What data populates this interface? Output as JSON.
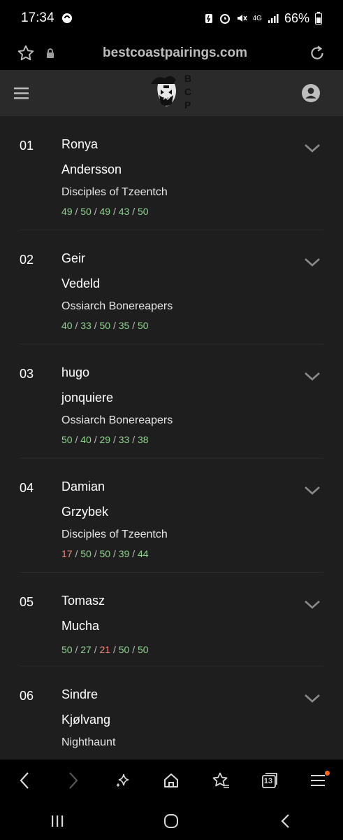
{
  "status_bar": {
    "time": "17:34",
    "network": "4G",
    "battery": "66%"
  },
  "address_bar": {
    "url": "bestcoastpairings.com"
  },
  "header": {
    "logo_letters": [
      "B",
      "C",
      "P"
    ]
  },
  "colors": {
    "score_good": "#8fd48f",
    "score_bad": "#f28b82",
    "header_bg": "#2a2a2a",
    "list_bg": "#1e1e1e",
    "notification": "#ff6d1f"
  },
  "players": [
    {
      "rank": "01",
      "first_name": "Ronya",
      "last_name": "Andersson",
      "faction": "Disciples of Tzeentch",
      "scores": [
        {
          "v": "49",
          "s": "g"
        },
        {
          "v": "50",
          "s": "g"
        },
        {
          "v": "49",
          "s": "g"
        },
        {
          "v": "43",
          "s": "g"
        },
        {
          "v": "50",
          "s": "g"
        }
      ]
    },
    {
      "rank": "02",
      "first_name": "Geir",
      "last_name": "Vedeld",
      "faction": "Ossiarch Bonereapers",
      "scores": [
        {
          "v": "40",
          "s": "g"
        },
        {
          "v": "33",
          "s": "g"
        },
        {
          "v": "50",
          "s": "g"
        },
        {
          "v": "35",
          "s": "g"
        },
        {
          "v": "50",
          "s": "g"
        }
      ]
    },
    {
      "rank": "03",
      "first_name": "hugo",
      "last_name": "jonquiere",
      "faction": "Ossiarch Bonereapers",
      "scores": [
        {
          "v": "50",
          "s": "g"
        },
        {
          "v": "40",
          "s": "g"
        },
        {
          "v": "29",
          "s": "g"
        },
        {
          "v": "33",
          "s": "g"
        },
        {
          "v": "38",
          "s": "g"
        }
      ]
    },
    {
      "rank": "04",
      "first_name": "Damian",
      "last_name": "Grzybek",
      "faction": "Disciples of Tzeentch",
      "scores": [
        {
          "v": "17",
          "s": "r"
        },
        {
          "v": "50",
          "s": "g"
        },
        {
          "v": "50",
          "s": "g"
        },
        {
          "v": "39",
          "s": "g"
        },
        {
          "v": "44",
          "s": "g"
        }
      ]
    },
    {
      "rank": "05",
      "first_name": "Tomasz",
      "last_name": "Mucha",
      "faction": "",
      "scores": [
        {
          "v": "50",
          "s": "g"
        },
        {
          "v": "27",
          "s": "g"
        },
        {
          "v": "21",
          "s": "r"
        },
        {
          "v": "50",
          "s": "g"
        },
        {
          "v": "50",
          "s": "g"
        }
      ]
    },
    {
      "rank": "06",
      "first_name": "Sindre",
      "last_name": "Kjølvang",
      "faction": "Nighthaunt",
      "scores": []
    }
  ],
  "browser_nav": {
    "tab_count": "13"
  }
}
